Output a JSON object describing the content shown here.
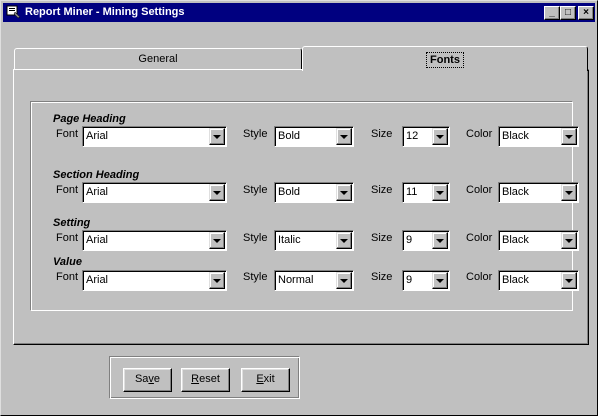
{
  "window": {
    "title": "Report Miner - Mining Settings",
    "controls": {
      "minimize": "_",
      "maximize": "□",
      "close": "×"
    }
  },
  "tabs": [
    {
      "label": "General",
      "selected": false
    },
    {
      "label": "Fonts",
      "selected": true
    }
  ],
  "labels": {
    "font": "Font",
    "style": "Style",
    "size": "Size",
    "color": "Color"
  },
  "sections": [
    {
      "title": "Page Heading",
      "font": "Arial",
      "style": "Bold",
      "size": "12",
      "color": "Black"
    },
    {
      "title": "Section Heading",
      "font": "Arial",
      "style": "Bold",
      "size": "11",
      "color": "Black"
    },
    {
      "title": "Setting",
      "font": "Arial",
      "style": "Italic",
      "size": "9",
      "color": "Black"
    },
    {
      "title": "Value",
      "font": "Arial",
      "style": "Normal",
      "size": "9",
      "color": "Black"
    }
  ],
  "buttons": {
    "save": {
      "pre": "Sa",
      "accel": "v",
      "post": "e"
    },
    "reset": {
      "pre": "",
      "accel": "R",
      "post": "eset"
    },
    "exit": {
      "pre": "",
      "accel": "E",
      "post": "xit"
    }
  },
  "colors": {
    "titlebar": "#000080",
    "face": "#c0c0c0"
  }
}
